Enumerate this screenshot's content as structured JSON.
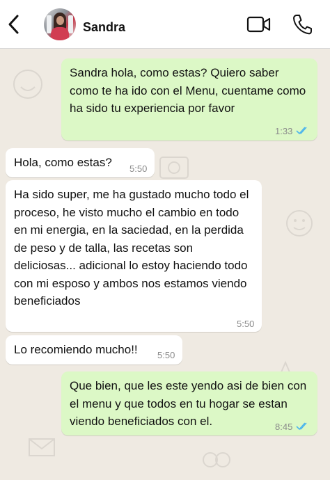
{
  "header": {
    "contact_name": "Sandra",
    "back_icon": "chevron-left-icon",
    "video_icon": "video-camera-icon",
    "call_icon": "phone-icon"
  },
  "colors": {
    "outgoing_bubble": "#dcf8c6",
    "incoming_bubble": "#ffffff",
    "chat_background": "#efeae2",
    "read_ticks": "#4fb6ec"
  },
  "messages": [
    {
      "direction": "outgoing",
      "text": "Sandra hola, como estas? Quiero saber como te ha ido con el Menu, cuentame como ha sido tu experiencia por favor",
      "time": "1:33",
      "status": "read"
    },
    {
      "direction": "incoming",
      "text": "Hola, como estas?",
      "time": "5:50"
    },
    {
      "direction": "incoming",
      "text": "Ha sido super, me ha gustado mucho todo el proceso,  he visto mucho el cambio en todo en mi energia, en la saciedad, en la perdida de peso y de talla, las recetas son deliciosas... adicional lo estoy haciendo todo con mi esposo y ambos nos estamos viendo beneficiados",
      "time": "5:50"
    },
    {
      "direction": "incoming",
      "text": "Lo recomiendo mucho!!",
      "time": "5:50"
    },
    {
      "direction": "outgoing",
      "text": "Que bien, que les este yendo asi de bien con el menu y que todos en tu hogar se estan viendo beneficiados con el.",
      "time": "8:45",
      "status": "read"
    }
  ]
}
